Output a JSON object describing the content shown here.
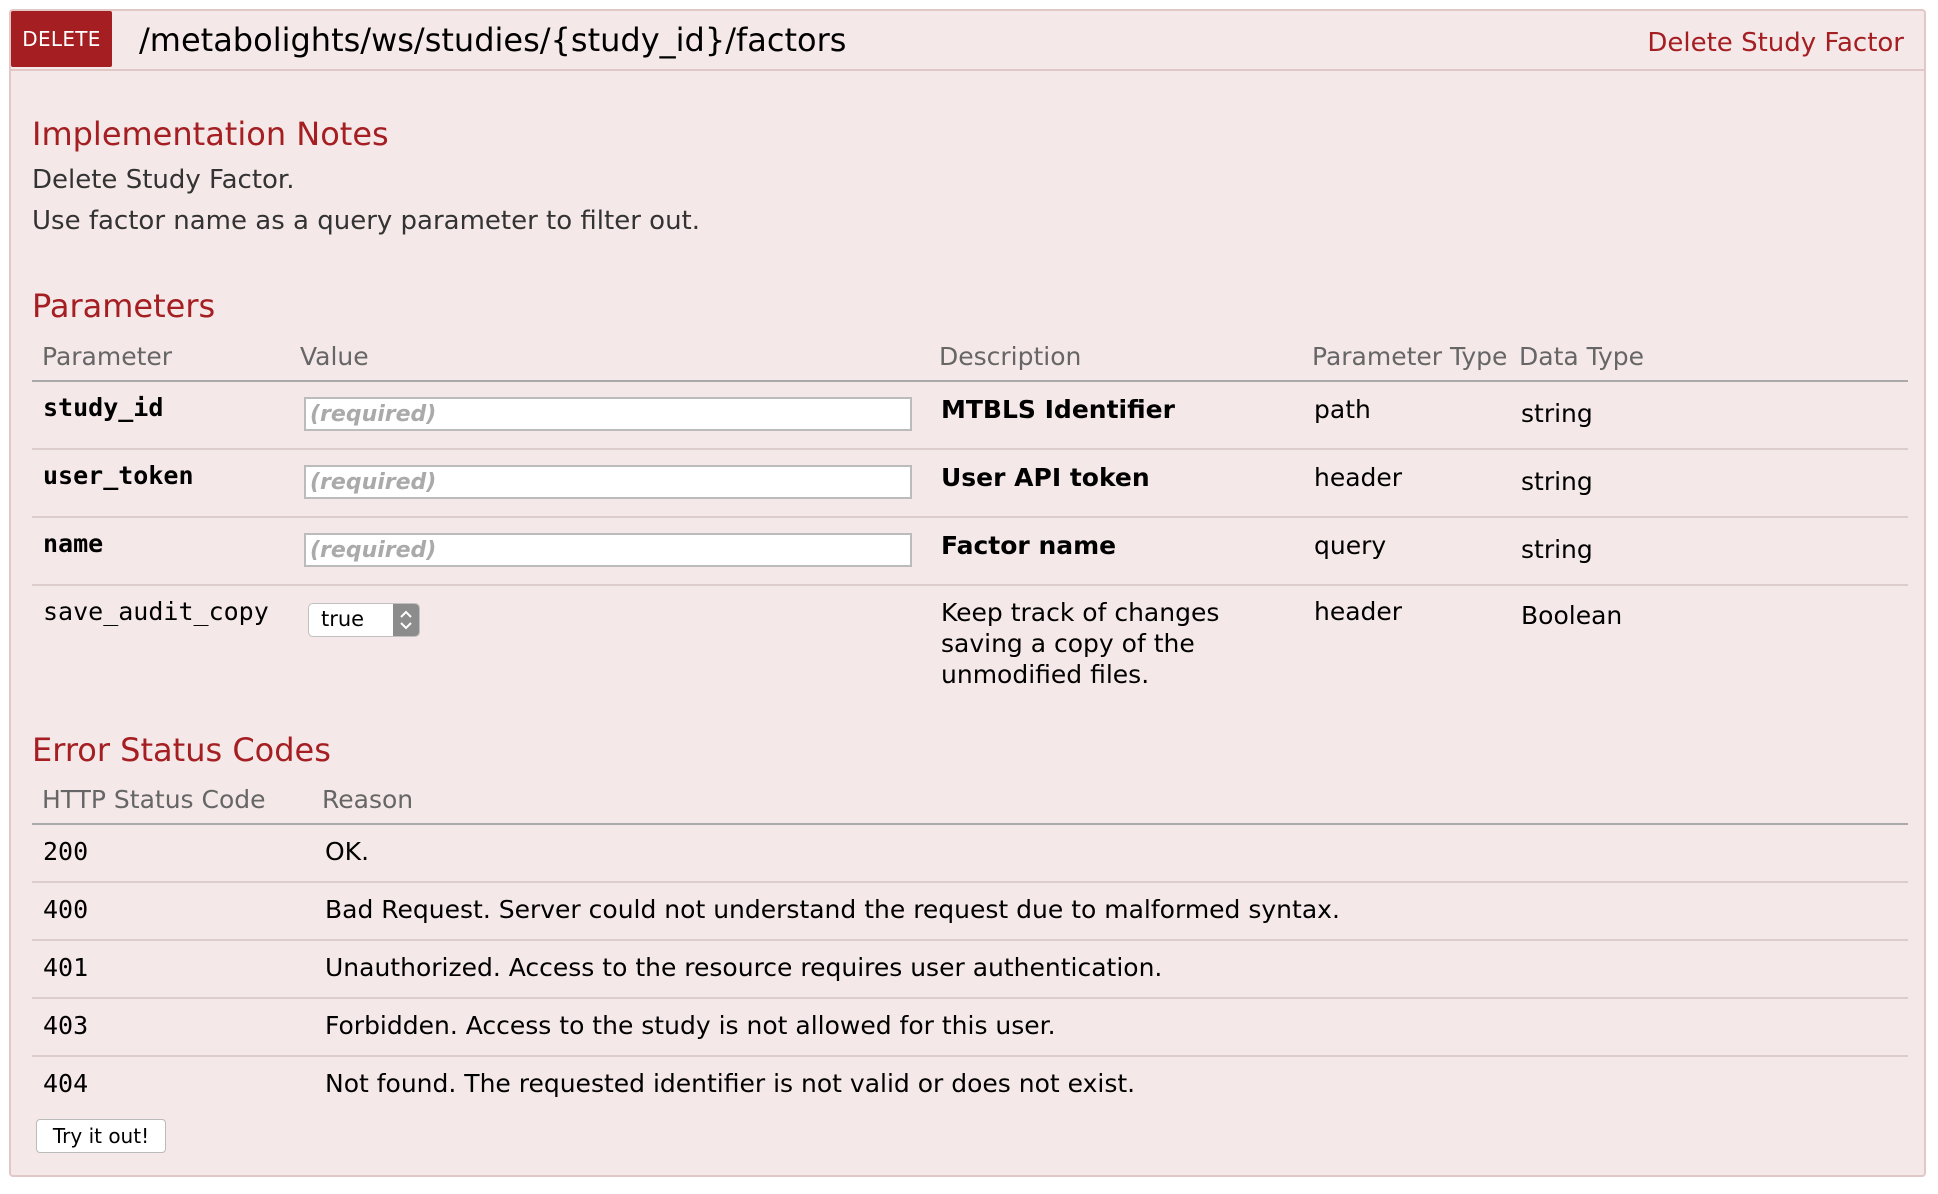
{
  "operation": {
    "method": "DELETE",
    "path": "/metabolights/ws/studies/{study_id}/factors",
    "summary": "Delete Study Factor"
  },
  "implementation_notes": {
    "title": "Implementation Notes",
    "lines": [
      "Delete Study Factor.",
      "Use factor name as a query parameter to filter out."
    ]
  },
  "parameters": {
    "title": "Parameters",
    "columns": [
      "Parameter",
      "Value",
      "Description",
      "Parameter Type",
      "Data Type"
    ],
    "rows": [
      {
        "name": "study_id",
        "placeholder": "(required)",
        "description": "MTBLS Identifier",
        "param_type": "path",
        "data_type": "string"
      },
      {
        "name": "user_token",
        "placeholder": "(required)",
        "description": "User API token",
        "param_type": "header",
        "data_type": "string"
      },
      {
        "name": "name",
        "placeholder": "(required)",
        "description": "Factor name",
        "param_type": "query",
        "data_type": "string"
      },
      {
        "name": "save_audit_copy",
        "selected": "true",
        "description": "Keep track of changes saving a copy of the unmodified files.",
        "param_type": "header",
        "data_type": "Boolean"
      }
    ]
  },
  "error_codes": {
    "title": "Error Status Codes",
    "columns": [
      "HTTP Status Code",
      "Reason"
    ],
    "rows": [
      {
        "code": "200",
        "reason": "OK."
      },
      {
        "code": "400",
        "reason": "Bad Request. Server could not understand the request due to malformed syntax."
      },
      {
        "code": "401",
        "reason": "Unauthorized. Access to the resource requires user authentication."
      },
      {
        "code": "403",
        "reason": "Forbidden. Access to the study is not allowed for this user."
      },
      {
        "code": "404",
        "reason": "Not found. The requested identifier is not valid or does not exist."
      }
    ]
  },
  "try_button": "Try it out!",
  "colors": {
    "method_bg": "#a41e22",
    "accent": "#a41e22",
    "panel_bg": "#f5e8e8",
    "panel_border": "#e2c7c7"
  }
}
